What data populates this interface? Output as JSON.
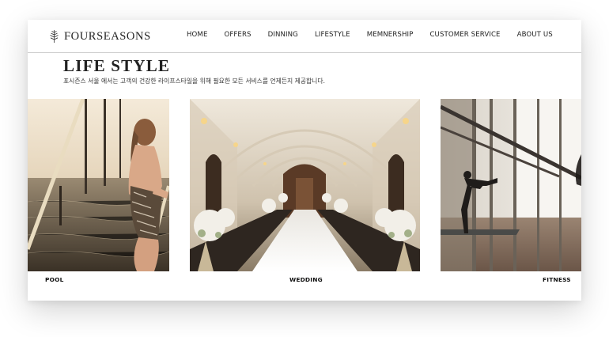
{
  "brand": {
    "name": "FOURSEASONS",
    "logo_icon": "leaf-icon"
  },
  "nav": {
    "items": [
      {
        "label": "HOME"
      },
      {
        "label": "OFFERS"
      },
      {
        "label": "DINNING"
      },
      {
        "label": "LIFESTYLE"
      },
      {
        "label": "MEMNERSHIP"
      },
      {
        "label": "CUSTOMER SERVICE"
      },
      {
        "label": "ABOUT US"
      }
    ]
  },
  "section": {
    "title": "LIFE STYLE",
    "description": "포시즌스 서울 에서는 고객의 건강한 라이프스타일을 위해 필요한 모든 서비스를 언제든지 제공합니다."
  },
  "gallery": [
    {
      "caption": "POOL"
    },
    {
      "caption": "WEDDING"
    },
    {
      "caption": "FITNESS"
    }
  ]
}
